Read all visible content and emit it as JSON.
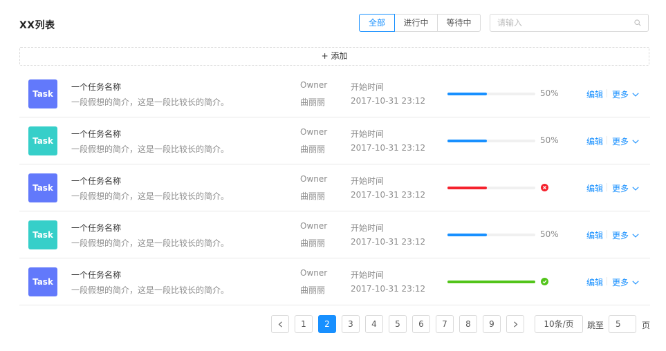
{
  "header": {
    "title": "XX列表",
    "filters": [
      "全部",
      "进行中",
      "等待中"
    ],
    "active_filter_index": 0,
    "search_placeholder": "请输入",
    "search_value": ""
  },
  "add_button": {
    "label": "+ 添加"
  },
  "colors": {
    "primary": "#1890ff",
    "avatar_blue": "#6279fb",
    "avatar_teal": "#36cfc9",
    "progress_blue": "#1890ff",
    "progress_red": "#f5222d",
    "progress_green": "#52c41a"
  },
  "list": {
    "items": [
      {
        "avatar": "Task",
        "avatar_color": "#6279fb",
        "name": "一个任务名称",
        "desc": "一段假想的简介，这是一段比较长的简介。",
        "owner_label": "Owner",
        "owner": "曲丽丽",
        "time_label": "开始时间",
        "time": "2017-10-31  23:12",
        "progress": 0.45,
        "progress_color": "#1890ff",
        "status": "active",
        "percent_text": "50%",
        "edit": "编辑",
        "more": "更多"
      },
      {
        "avatar": "Task",
        "avatar_color": "#36cfc9",
        "name": "一个任务名称",
        "desc": "一段假想的简介，这是一段比较长的简介。",
        "owner_label": "Owner",
        "owner": "曲丽丽",
        "time_label": "开始时间",
        "time": "2017-10-31  23:12",
        "progress": 0.45,
        "progress_color": "#1890ff",
        "status": "active",
        "percent_text": "50%",
        "edit": "编辑",
        "more": "更多"
      },
      {
        "avatar": "Task",
        "avatar_color": "#6279fb",
        "name": "一个任务名称",
        "desc": "一段假想的简介，这是一段比较长的简介。",
        "owner_label": "Owner",
        "owner": "曲丽丽",
        "time_label": "开始时间",
        "time": "2017-10-31  23:12",
        "progress": 0.45,
        "progress_color": "#f5222d",
        "status": "exception",
        "percent_text": "",
        "edit": "编辑",
        "more": "更多"
      },
      {
        "avatar": "Task",
        "avatar_color": "#36cfc9",
        "name": "一个任务名称",
        "desc": "一段假想的简介，这是一段比较长的简介。",
        "owner_label": "Owner",
        "owner": "曲丽丽",
        "time_label": "开始时间",
        "time": "2017-10-31  23:12",
        "progress": 0.45,
        "progress_color": "#1890ff",
        "status": "active",
        "percent_text": "50%",
        "edit": "编辑",
        "more": "更多"
      },
      {
        "avatar": "Task",
        "avatar_color": "#6279fb",
        "name": "一个任务名称",
        "desc": "一段假想的简介，这是一段比较长的简介。",
        "owner_label": "Owner",
        "owner": "曲丽丽",
        "time_label": "开始时间",
        "time": "2017-10-31  23:12",
        "progress": 1.0,
        "progress_color": "#52c41a",
        "status": "success",
        "percent_text": "",
        "edit": "编辑",
        "more": "更多"
      }
    ]
  },
  "pagination": {
    "pages": [
      "1",
      "2",
      "3",
      "4",
      "5",
      "6",
      "7",
      "8",
      "9"
    ],
    "current": "2",
    "page_size_label": "10条/页",
    "jump_label": "跳至",
    "jump_value": "5",
    "page_suffix": "页",
    "icons": {
      "prev": "chevron-left-icon",
      "next": "chevron-right-icon"
    }
  }
}
